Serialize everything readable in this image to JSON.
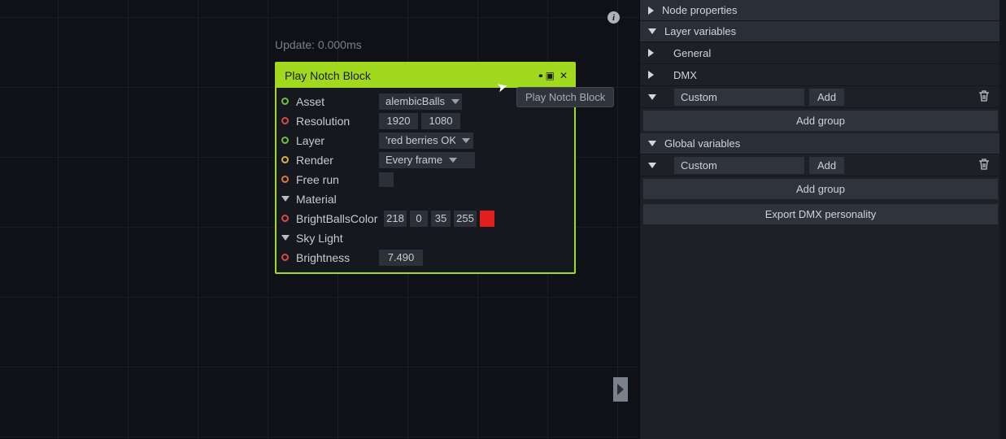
{
  "canvas": {
    "update_text": "Update: 0.000ms"
  },
  "tooltip": "Play Notch Block",
  "node": {
    "title": "Play Notch Block",
    "params": {
      "asset": {
        "label": "Asset",
        "value": "alembicBalls"
      },
      "resolution": {
        "label": "Resolution",
        "w": "1920",
        "h": "1080"
      },
      "layer": {
        "label": "Layer",
        "value": "'red berries OK "
      },
      "render": {
        "label": "Render",
        "value": "Every frame"
      },
      "freerun": {
        "label": "Free run"
      },
      "material": {
        "label": "Material"
      },
      "bbc": {
        "label": "BrightBallsColor",
        "r": "218",
        "g": "0",
        "b": "35",
        "a": "255",
        "swatch": "#e21f1f"
      },
      "sky": {
        "label": "Sky Light"
      },
      "brightness": {
        "label": "Brightness",
        "value": "7.490"
      }
    }
  },
  "rpanel": {
    "node_properties": "Node properties",
    "layer_variables": "Layer variables",
    "general": "General",
    "dmx": "DMX",
    "custom": "Custom",
    "add": "Add",
    "add_group": "Add group",
    "global_variables": "Global variables",
    "export": "Export DMX personality"
  }
}
